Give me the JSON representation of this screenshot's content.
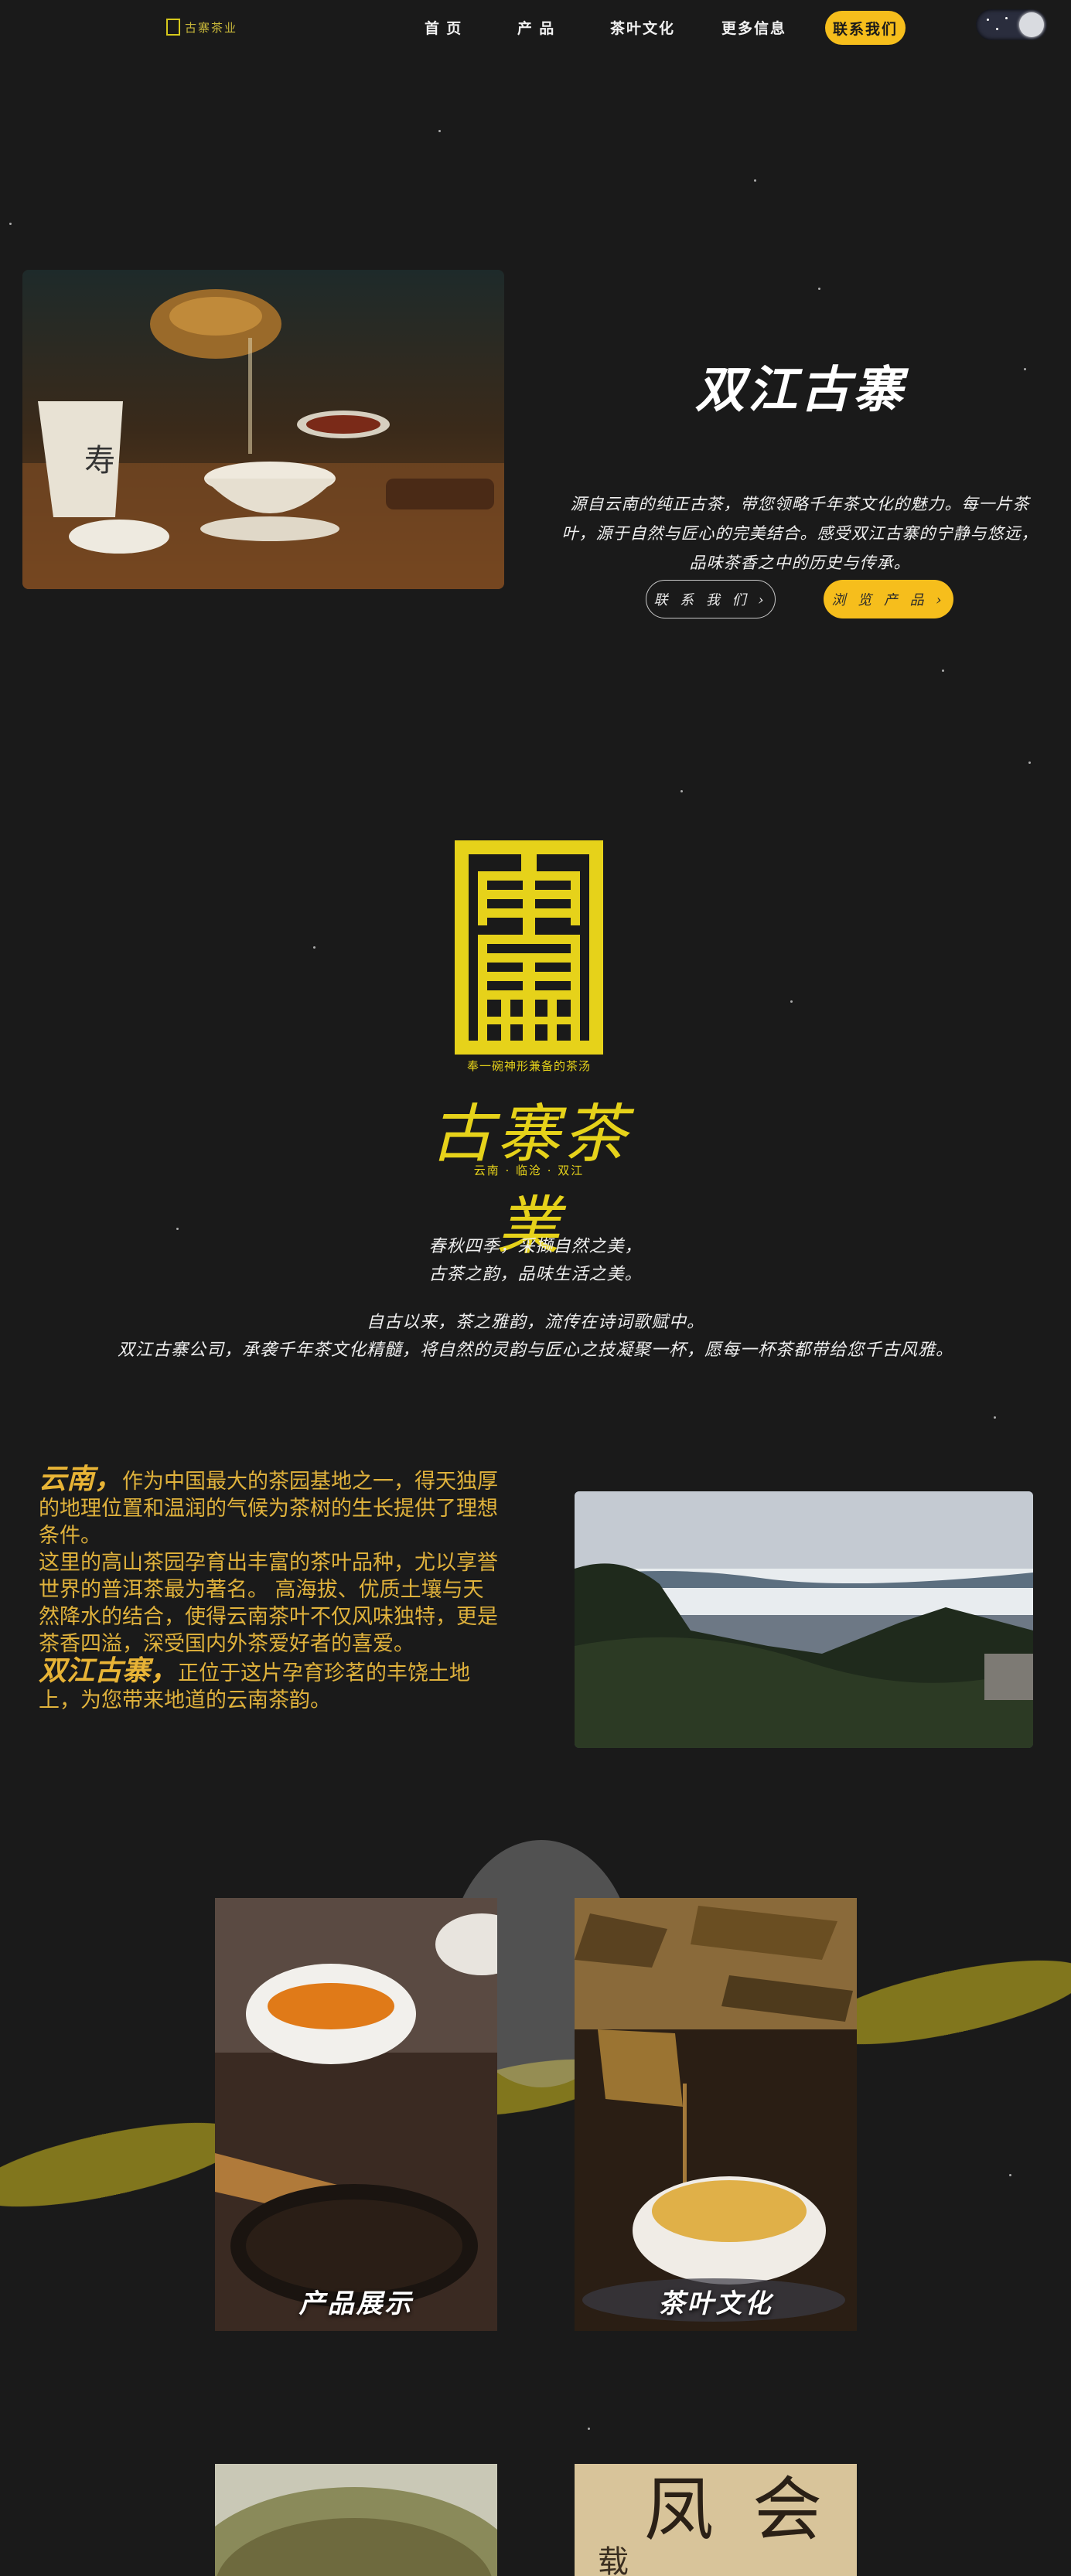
{
  "nav": {
    "logo_text": "古寨茶业",
    "items": [
      {
        "label": "首 页"
      },
      {
        "label": "产 品"
      },
      {
        "label": "茶叶文化"
      },
      {
        "label": "更多信息"
      }
    ],
    "cta": "联系我们",
    "theme_toggle": "dark-mode-toggle"
  },
  "hero": {
    "title": "双江古寨",
    "description": "源自云南的纯正古茶，带您领略千年茶文化的魅力。每一片茶叶，源于自然与匠心的完美结合。感受双江古寨的宁静与悠远，品味茶香之中的历史与传承。",
    "btn_contact": "联 系 我 们 ›",
    "btn_products": "浏 览 产 品 ›"
  },
  "brand": {
    "tagline": "奉一碗神形兼备的茶汤",
    "name": "古寨茶業",
    "location": "云南 · 临沧 · 双江"
  },
  "poem": {
    "line1": "春秋四季，采撷自然之美，",
    "line2": "古茶之韵，品味生活之美。"
  },
  "intro": {
    "line1": "自古以来，茶之雅韵，流传在诗词歌赋中。",
    "line2": "双江古寨公司，承袭千年茶文化精髓，将自然的灵韵与匠心之技凝聚一杯，愿每一杯茶都带给您千古风雅。"
  },
  "yunnan": {
    "em1": "云南，",
    "p1": "作为中国最大的茶园基地之一，得天独厚的地理位置和温润的气候为茶树的生长提供了理想条件。",
    "p2": "这里的高山茶园孕育出丰富的茶叶品种，尤以享誉世界的普洱茶最为著名。 高海拔、优质土壤与天然降水的结合，使得云南茶叶不仅风味独特，更是茶香四溢，深受国内外茶爱好者的喜爱。",
    "em2": "双江古寨，",
    "p3": "正位于这片孕育珍茗的丰饶土地上，为您带来地道的云南茶韵。"
  },
  "gallery": {
    "products_label": "产品展示",
    "culture_label": "茶叶文化"
  },
  "colors": {
    "background": "#1a1a1a",
    "accent": "#f6be1c",
    "logo_yellow": "#e6d21a",
    "text_gold": "#e0b23c"
  }
}
